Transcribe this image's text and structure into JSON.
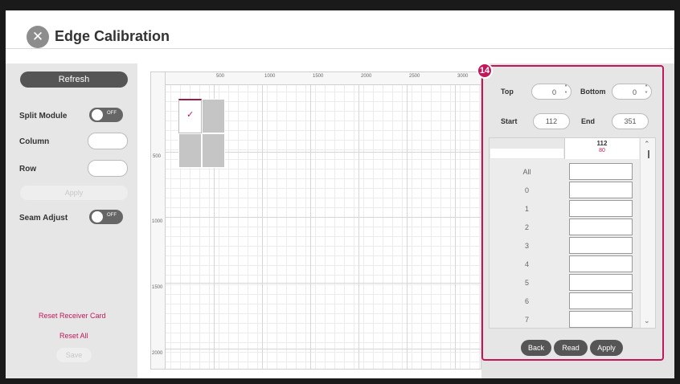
{
  "window": {
    "title": "Edge Calibration"
  },
  "left_panel": {
    "refresh_label": "Refresh",
    "split_module_label": "Split Module",
    "split_module_state": "OFF",
    "column_label": "Column",
    "column_value": "",
    "row_label": "Row",
    "row_value": "",
    "apply_label": "Apply",
    "seam_adjust_label": "Seam Adjust",
    "seam_adjust_state": "OFF",
    "reset_receiver_card_label": "Reset Receiver Card",
    "reset_all_label": "Reset All",
    "save_label": "Save"
  },
  "canvas": {
    "x_ticks": [
      "500",
      "1000",
      "1500",
      "2000",
      "2500",
      "3000"
    ],
    "y_ticks": [
      "500",
      "1000",
      "1500",
      "2000"
    ],
    "selected_module_icon": "checkmark-icon"
  },
  "right_panel": {
    "badge": "14",
    "top_label": "Top",
    "top_value": "0",
    "bottom_label": "Bottom",
    "bottom_value": "0",
    "start_label": "Start",
    "start_value": "112",
    "end_label": "End",
    "end_value": "351",
    "table": {
      "column_header": "112",
      "column_subheader": "80",
      "rows": [
        "All",
        "0",
        "1",
        "2",
        "3",
        "4",
        "5",
        "6",
        "7"
      ]
    },
    "back_label": "Back",
    "read_label": "Read",
    "apply_label": "Apply"
  },
  "colors": {
    "accent": "#c2185b",
    "dark_button": "#555555",
    "panel_bg": "#e6e6e6"
  }
}
